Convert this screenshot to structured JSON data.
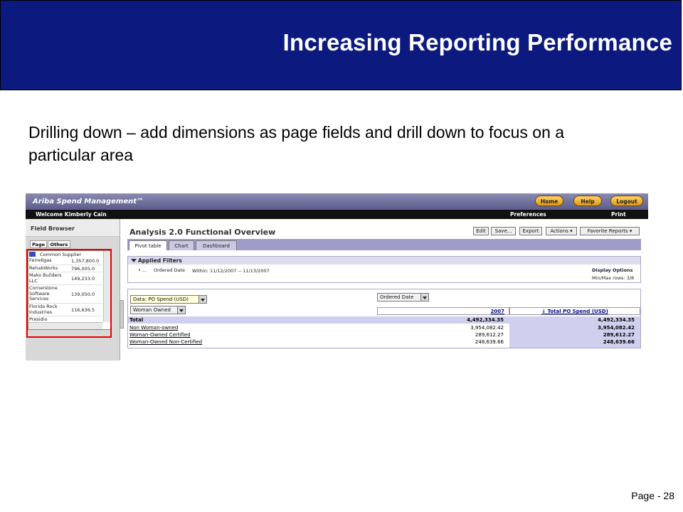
{
  "slide": {
    "title": "Increasing Reporting Performance",
    "lead": "Drilling down – add dimensions as page fields and drill down to focus on a particular area",
    "page_number": "Page - 28"
  },
  "app": {
    "brand": "Ariba Spend Management™",
    "nav_buttons": {
      "home": "Home",
      "help": "Help",
      "logout": "Logout"
    },
    "welcome": "Welcome Kimberly Cain",
    "preferences": "Preferences",
    "print": "Print",
    "field_browser": {
      "title": "Field Browser",
      "tabs": [
        "Page",
        "Others"
      ],
      "list_header": "Common Supplier",
      "items": [
        {
          "name": "Ferrellgas",
          "value": "1,357,800.0"
        },
        {
          "name": "RehabWorks",
          "value": "796,005.0"
        },
        {
          "name": "Mako Builders LLC",
          "value": "149,233.0"
        },
        {
          "name": "Cornerstone Software Services",
          "value": "139,050.0"
        },
        {
          "name": "Florida Rock Industries",
          "value": "116,636.5"
        },
        {
          "name": "Presidio",
          "value": ""
        }
      ]
    },
    "analysis": {
      "title": "Analysis 2.0 Functional Overview",
      "toolbar": {
        "edit": "Edit",
        "save": "Save...",
        "export": "Export",
        "actions": "Actions",
        "favorites": "Favorite Reports"
      },
      "tabs": [
        {
          "label": "Pivot table",
          "active": true
        },
        {
          "label": "Chart",
          "active": false
        },
        {
          "label": "Dashboard",
          "active": false
        }
      ],
      "applied_filters": {
        "title": "Applied Filters",
        "bullet": "• ...",
        "filter_name": "Ordered Date",
        "filter_value": "Within: 11/12/2007 -- 11/13/2007",
        "display_options": "Display Options",
        "min_max": "Min/Max rows: 3/8"
      },
      "pivot": {
        "measure_select": "Data: PO Spend (USD)",
        "column_field": "Ordered Date",
        "row_field": "Woman Owned",
        "column_header": "2007",
        "total_header": "↓ Total PO Spend (USD)",
        "rows": [
          {
            "label": "Total",
            "value": "4,492,334.35",
            "total": "4,492,334.35"
          },
          {
            "label": "Non Woman-owned",
            "value": "3,954,082.42",
            "total": "3,954,082.42"
          },
          {
            "label": "Woman-Owned Certified",
            "value": "289,612.27",
            "total": "289,612.27"
          },
          {
            "label": "Woman-Owned Non-Certified",
            "value": "248,639.66",
            "total": "248,639.66"
          }
        ]
      }
    }
  }
}
